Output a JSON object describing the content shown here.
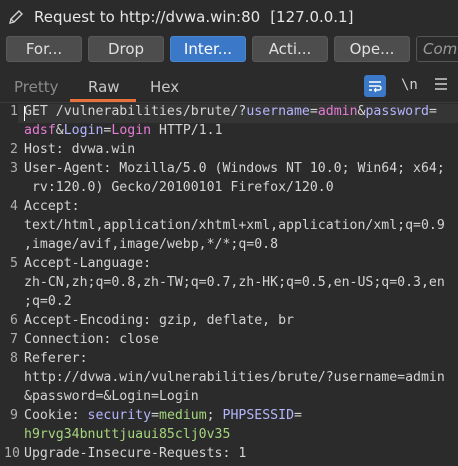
{
  "window": {
    "title": "Request to http://dvwa.win:80",
    "ip": "[127.0.0.1]"
  },
  "buttons": [
    {
      "label": "For..."
    },
    {
      "label": "Drop"
    },
    {
      "label": "Inter..."
    },
    {
      "label": "Acti..."
    },
    {
      "label": "Ope..."
    },
    {
      "label": "Com"
    }
  ],
  "tabs": {
    "pretty": "Pretty",
    "raw": "Raw",
    "hex": "Hex",
    "newline_toggle": "\\n"
  },
  "request": {
    "line1_method": "GET",
    "line1_path": "/vulnerabilities/brute/?",
    "p1_name": "username",
    "p1_value": "admin",
    "p2_name": "password",
    "p2_value": "adsf",
    "p3_name": "Login",
    "p3_value": "Login",
    "line1_proto": " HTTP/1.1",
    "host": "Host: dvwa.win",
    "ua_a": "User-Agent: Mozilla/5.0 (Windows NT 10.0; Win64; x64;",
    "ua_b": " rv:120.0) Gecko/20100101 Firefox/120.0",
    "accept_a": "Accept:",
    "accept_b": "text/html,application/xhtml+xml,application/xml;q=0.9",
    "accept_c": ",image/avif,image/webp,*/*;q=0.8",
    "al_a": "Accept-Language:",
    "al_b": "zh-CN,zh;q=0.8,zh-TW;q=0.7,zh-HK;q=0.5,en-US;q=0.3,en",
    "al_c": ";q=0.2",
    "ae": "Accept-Encoding: gzip, deflate, br",
    "conn": "Connection: close",
    "ref_a": "Referer:",
    "ref_b": "http://dvwa.win/vulnerabilities/brute/?username=admin",
    "ref_c": "&password=&Login=Login",
    "cookie_label": "Cookie: ",
    "c1_name": "security",
    "c1_value": "medium",
    "c2_name": "PHPSESSID",
    "c2_value": "h9rvg34bnuttjuaui85clj0v35",
    "uir": "Upgrade-Insecure-Requests: 1"
  },
  "line_numbers": [
    "1",
    "2",
    "3",
    "4",
    "5",
    "6",
    "7",
    "8",
    "9",
    "10"
  ],
  "colors": {
    "background": "#2b2b2b",
    "accent": "#3b78c8",
    "tab_underline": "#e8703a",
    "param_name": "#b5b5ff",
    "param_value": "#e57bd6",
    "cookie_value": "#a5d67d"
  }
}
